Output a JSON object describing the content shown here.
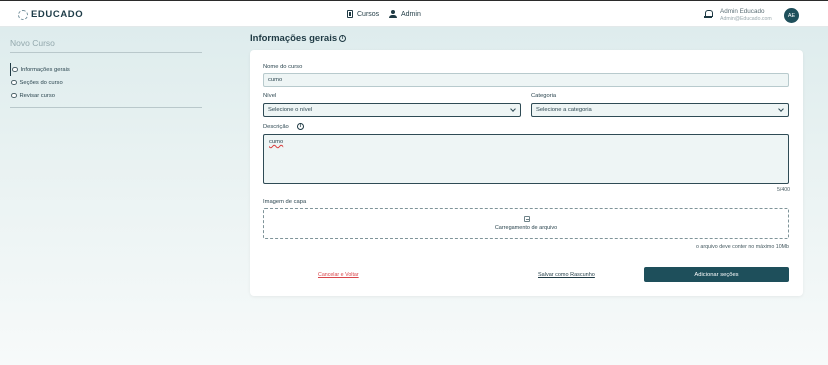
{
  "header": {
    "logo_text": "EDUCADO",
    "nav": [
      {
        "label": "Cursos",
        "icon": "document-icon"
      },
      {
        "label": "Admin",
        "icon": "person-icon"
      }
    ],
    "user_name": "Admin Educado",
    "user_email": "Admin@Educado.com",
    "avatar_initials": "AE"
  },
  "sidebar": {
    "title": "Novo Curso",
    "steps": [
      {
        "label": "Informações gerais",
        "active": true
      },
      {
        "label": "Seções do curso",
        "active": false
      },
      {
        "label": "Revisar curso",
        "active": false
      }
    ]
  },
  "main": {
    "title": "Informações gerais",
    "form": {
      "name_label": "Nome do curso",
      "name_value": "cumo",
      "level_label": "Nível",
      "level_value": "Selecione o nível",
      "category_label": "Categoria",
      "category_value": "Selecione a categoria",
      "description_label": "Descrição",
      "description_value": "cumo",
      "char_count": "5/400",
      "cover_label": "Imagem de capa",
      "upload_text": "Carregamento de arquivo",
      "upload_hint": "o arquivo deve conter no máximo 10Mb"
    },
    "actions": {
      "cancel": "Cancelar e Voltar",
      "save_draft": "Salvar como Rascunho",
      "primary": "Adicionar seções"
    }
  },
  "colors": {
    "primary": "#1e4f5b",
    "danger": "#d9454a",
    "field_bg": "#eef5f5"
  }
}
